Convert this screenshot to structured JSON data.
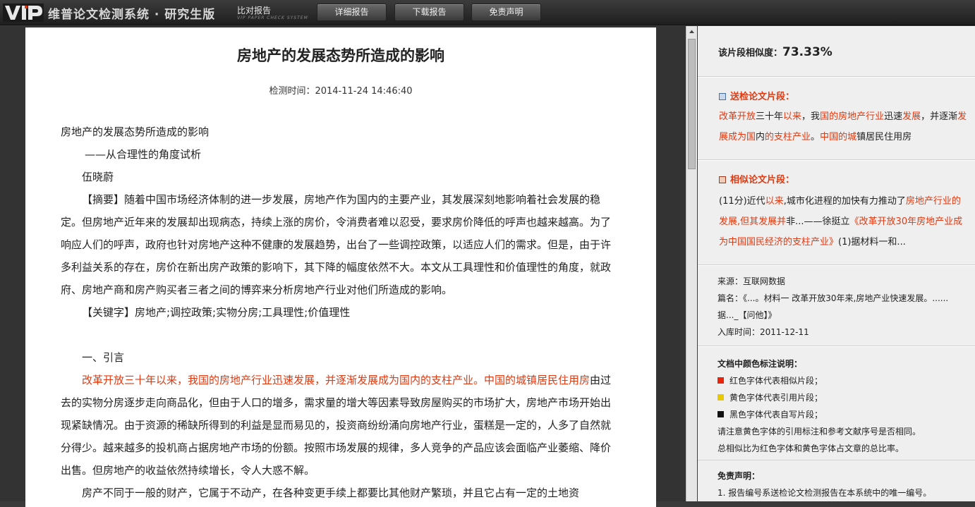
{
  "header": {
    "logo_text": "VIP",
    "brand": "维普论文检测系统 · 研究生版",
    "subtitle": "比对报告",
    "subtitle_en": "VIP PAPER CHECK SYSTEM",
    "buttons": [
      "详细报告",
      "下载报告",
      "免责声明"
    ]
  },
  "document": {
    "title": "房地产的发展态势所造成的影响",
    "time_label": "检测时间：2014-11-24 14:46:40",
    "heading": "房地产的发展态势所造成的影响",
    "subheading": "——从合理性的角度试析",
    "author": "伍晓蔚",
    "abstract": "【摘要】随着中国市场经济体制的进一步发展，房地产作为国内的主要产业，其发展深刻地影响着社会发展的稳定。但房地产近年来的发展却出现病态，持续上涨的房价，令消费者难以忍受，要求房价降低的呼声也越来越高。为了响应人们的呼声，政府也针对房地产这种不健康的发展趋势，出台了一些调控政策，以适应人们的需求。但是，由于许多利益关系的存在，房价在新出房产政策的影响下，其下降的幅度依然不大。本文从工具理性和价值理性的角度，就政府、房地产商和房产购买者三者之间的博弈来分析房地产行业对他们所造成的影响。",
    "keywords": "【关键字】房地产;调控政策;实物分房;工具理性;价值理性",
    "section1": "一、引言",
    "para1_red": "改革开放三十年以来，我国的房地产行业迅速发展，并逐渐发展成为国内的支柱产业。中国的城镇居民住用房",
    "para1_black": "由过去的实物分房逐步走向商品化，但由于人口的增多，需求量的增大等因素导致房屋购买的市场扩大，房地产市场开始出现紧缺情况。由于资源的稀缺所得到的利益是显而易见的，投资商纷纷涌向房地产行业，蛋糕是一定的，人多了自然就分得少。越来越多的投机商占据房地产市场的份额。按照市场发展的规律，多人竞争的产品应该会面临产业萎缩、降价出售。但房地产的收益依然持续增长，令人大惑不解。",
    "para2": "房产不同于一般的财产，它属于不动产，在各种变更手续上都要比其他财产繁琐，并且它占有一定的土地资"
  },
  "panel": {
    "similarity_label": "该片段相似度：",
    "similarity_value": "73.33%",
    "submitted_heading": "送检论文片段：",
    "submitted_segments": [
      {
        "text": "改革开放",
        "red": true
      },
      {
        "text": "三十年",
        "red": false
      },
      {
        "text": "以来",
        "red": true
      },
      {
        "text": "，我",
        "red": false
      },
      {
        "text": "国的房地产行业",
        "red": true
      },
      {
        "text": "迅速",
        "red": false
      },
      {
        "text": "发展",
        "red": true
      },
      {
        "text": "，并逐渐",
        "red": false
      },
      {
        "text": "发展成为国",
        "red": true
      },
      {
        "text": "内",
        "red": false
      },
      {
        "text": "的支柱产业",
        "red": true
      },
      {
        "text": "。",
        "red": false
      },
      {
        "text": "中国的城",
        "red": true
      },
      {
        "text": "镇居民住用房",
        "red": false
      }
    ],
    "similar_heading": "相似论文片段：",
    "similar_segments": [
      {
        "text": "(11分)近代",
        "red": false
      },
      {
        "text": "以来",
        "red": true
      },
      {
        "text": ",城市化进程的加快有力推动了",
        "red": false
      },
      {
        "text": "房地产行业的发展,但其发展并",
        "red": true
      },
      {
        "text": "非...——徐挺立",
        "red": false
      },
      {
        "text": "《改革开放30年房地产业成为中国国民经济的支柱产业》",
        "red": true
      },
      {
        "text": "(1)据材料一和...",
        "red": false
      }
    ],
    "source_label": "来源：互联网数据",
    "title_label": "篇名：《...。材料一 改革开放30年来,房地产业快速发展。......",
    "title_label_cont": "据..._【问他】》",
    "date_label": "入库时间：2011-12-11",
    "legend_title": "文档中颜色标注说明：",
    "legend_items": [
      {
        "color": "#e8250c",
        "label": "红色字体代表相似片段；"
      },
      {
        "color": "#e8c800",
        "label": "黄色字体代表引用片段；"
      },
      {
        "color": "#111111",
        "label": "黑色字体代表自写片段；"
      }
    ],
    "legend_note1": "请注意黄色字体的引用标注和参考文献序号是否相同。",
    "legend_note2": "总相似比为红色字体和黄色字体占文章的总比率。",
    "disclaimer_title": "免责声明：",
    "disclaimer_item1": "1. 报告编号系送检论文检测报告在本系统中的唯一编号。"
  }
}
